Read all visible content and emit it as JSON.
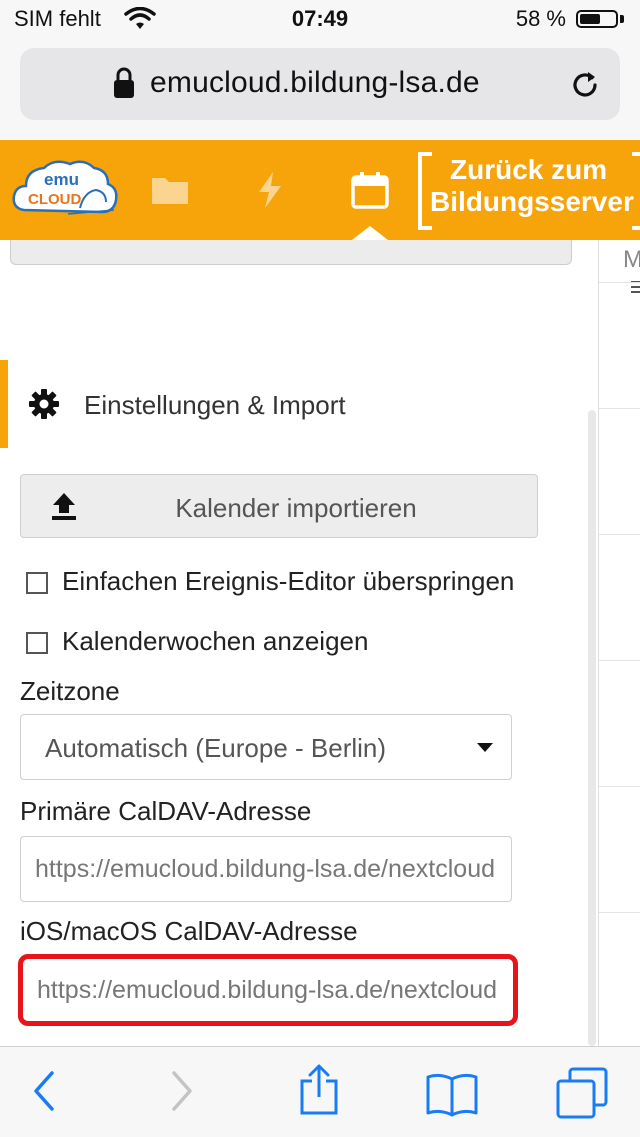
{
  "status_bar": {
    "carrier": "SIM fehlt",
    "time": "07:49",
    "battery_percent_text": "58 %",
    "battery_level": 0.58,
    "icons": [
      "wifi-icon",
      "battery-icon"
    ]
  },
  "browser": {
    "url": "emucloud.bildung-lsa.de",
    "icons": [
      "lock-icon",
      "reload-icon"
    ]
  },
  "app_header": {
    "logo_text_top": "emu",
    "logo_text_bottom": "CLOUD",
    "nav_items": [
      {
        "name": "files",
        "icon": "folder-icon",
        "active": false
      },
      {
        "name": "activity",
        "icon": "lightning-icon",
        "active": false
      },
      {
        "name": "calendar",
        "icon": "calendar-icon",
        "active": true
      }
    ],
    "back_link_line1": "Zurück zum",
    "back_link_line2": "Bildungsserver",
    "background_color": "#f7a30a"
  },
  "right_panel": {
    "partial_text": "M"
  },
  "settings": {
    "title": "Einstellungen & Import",
    "import_button_label": "Kalender importieren",
    "checkboxes": [
      {
        "label": "Einfachen Ereignis-Editor überspringen",
        "checked": false
      },
      {
        "label": "Kalenderwochen anzeigen",
        "checked": false
      }
    ],
    "timezone_label": "Zeitzone",
    "timezone_value": "Automatisch (Europe - Berlin)",
    "primary_caldav_label": "Primäre CalDAV-Adresse",
    "primary_caldav_value": "https://emucloud.bildung-lsa.de/nextcloud",
    "ios_caldav_label": "iOS/macOS CalDAV-Adresse",
    "ios_caldav_value": "https://emucloud.bildung-lsa.de/nextcloud",
    "highlight_color": "#e8141c"
  },
  "toolbar": {
    "items": [
      "back-icon",
      "forward-icon",
      "share-icon",
      "bookmarks-icon",
      "tabs-icon"
    ],
    "accent_color": "#1a7cf5"
  }
}
